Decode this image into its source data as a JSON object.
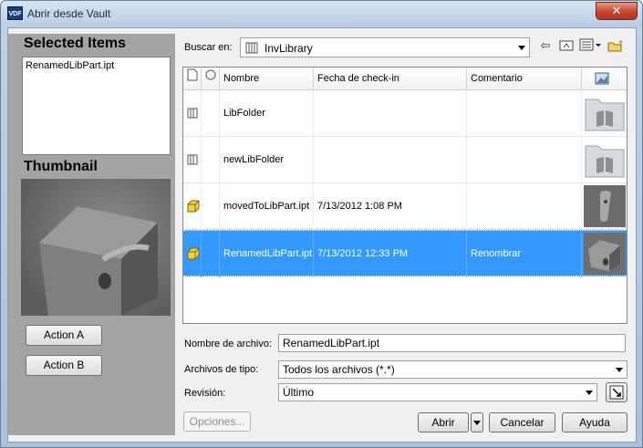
{
  "window": {
    "title": "Abrir desde Vault",
    "icon_text": "VDF",
    "close_symbol": "✕"
  },
  "left_panel": {
    "selected_title": "Selected Items",
    "selected_items": [
      "RenamedLibPart.ipt"
    ],
    "thumbnail_title": "Thumbnail",
    "action_a": "Action A",
    "action_b": "Action B"
  },
  "lookin": {
    "label": "Buscar en:",
    "value": "InvLibrary"
  },
  "grid": {
    "columns": [
      "Nombre",
      "Fecha de check-in",
      "Comentario"
    ],
    "rows": [
      {
        "name": "LibFolder",
        "date": "",
        "comment": "",
        "icon": "library-folder-icon",
        "thumb": "folder-thumbnail"
      },
      {
        "name": "newLibFolder",
        "date": "",
        "comment": "",
        "icon": "library-folder-icon",
        "thumb": "folder-thumbnail"
      },
      {
        "name": "movedToLibPart.ipt",
        "date": "7/13/2012 1:08 PM",
        "comment": "",
        "icon": "part-file-icon",
        "thumb": "part-thumbnail"
      },
      {
        "name": "RenamedLibPart.ipt",
        "date": "7/13/2012 12:33 PM",
        "comment": "Renombrar",
        "icon": "part-file-icon",
        "thumb": "part-thumbnail"
      }
    ],
    "selected_index": 3
  },
  "form": {
    "filename_label": "Nombre de archivo:",
    "filename_value": "RenamedLibPart.ipt",
    "filetype_label": "Archivos de tipo:",
    "filetype_value": "Todos los archivos (*.*)",
    "revision_label": "Revisión:",
    "revision_value": "Último"
  },
  "buttons": {
    "options": "Opciones...",
    "open": "Abrir",
    "cancel": "Cancelar",
    "help": "Ayuda"
  },
  "colors": {
    "selection": "#3399ff",
    "panel": "#a4a4a4"
  }
}
